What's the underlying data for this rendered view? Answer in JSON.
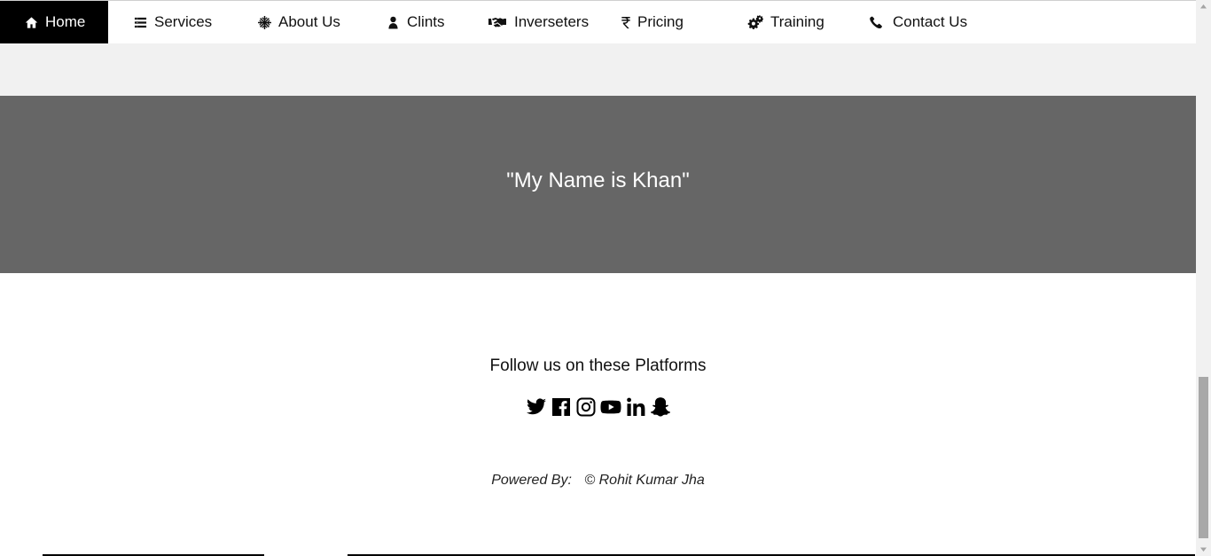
{
  "nav": {
    "items": [
      {
        "label": "Home",
        "icon": "home-icon"
      },
      {
        "label": "Services",
        "icon": "list-icon"
      },
      {
        "label": "About Us",
        "icon": "snowflake-icon"
      },
      {
        "label": "Clints",
        "icon": "user-icon"
      },
      {
        "label": "Inverseters",
        "icon": "handshake-icon"
      },
      {
        "label": "Pricing",
        "icon": "rupee-icon"
      },
      {
        "label": "Training",
        "icon": "gears-icon"
      },
      {
        "label": "Contact Us",
        "icon": "phone-icon"
      }
    ],
    "active_color": "#000000"
  },
  "quote": {
    "text": "\"My Name is Khan\"",
    "band_color": "#666666"
  },
  "follow": {
    "title": "Follow us on these Platforms",
    "icons": [
      "twitter-icon",
      "facebook-icon",
      "instagram-icon",
      "youtube-icon",
      "linkedin-icon",
      "snapchat-icon"
    ]
  },
  "footer": {
    "powered_label": "Powered By:",
    "credit": "© Rohit Kumar Jha"
  }
}
